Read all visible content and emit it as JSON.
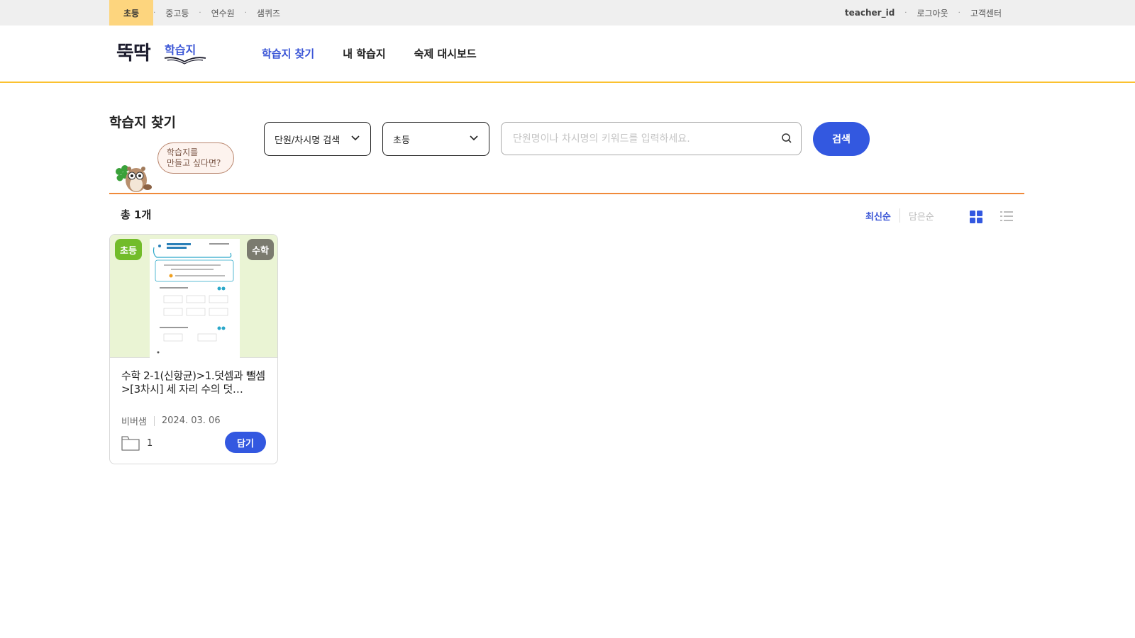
{
  "topbar": {
    "tabs": [
      {
        "label": "초등",
        "active": true
      },
      {
        "label": "중고등",
        "active": false
      },
      {
        "label": "연수원",
        "active": false
      },
      {
        "label": "샘퀴즈",
        "active": false
      }
    ],
    "separator": "·",
    "user": "teacher_id",
    "logout": "로그아웃",
    "support": "고객센터"
  },
  "header": {
    "logo_main": "뚝딱",
    "logo_sub": "학습지",
    "nav": [
      {
        "label": "학습지 찾기",
        "active": true
      },
      {
        "label": "내 학습지",
        "active": false
      },
      {
        "label": "숙제 대시보드",
        "active": false
      }
    ]
  },
  "search": {
    "title": "학습지 찾기",
    "helper_line1": "학습지를",
    "helper_line2": "만들고 싶다면?",
    "type_select": "단원/차시명 검색",
    "level_select": "초등",
    "placeholder": "단원명이나 차시명의 키워드를 입력하세요.",
    "button": "검색"
  },
  "results": {
    "total": "총 1개",
    "sort_latest": "최신순",
    "sort_saved": "담은순",
    "view_mode": "grid"
  },
  "cards": [
    {
      "level": "초등",
      "subject": "수학",
      "title": "수학 2-1(신항균)>1.덧셈과 뺄셈>[3차시] 세 자리 수의 덧…",
      "author": "비버샘",
      "date": "2024. 03. 06",
      "count": "1",
      "action": "담기"
    }
  ],
  "colors": {
    "accent": "#3358e0",
    "active_tab": "#fdd57e",
    "divider": "#f08a3a",
    "header_line": "#fbc12f",
    "level_badge": "#72bc2a",
    "subject_badge": "#7b7b6f"
  }
}
